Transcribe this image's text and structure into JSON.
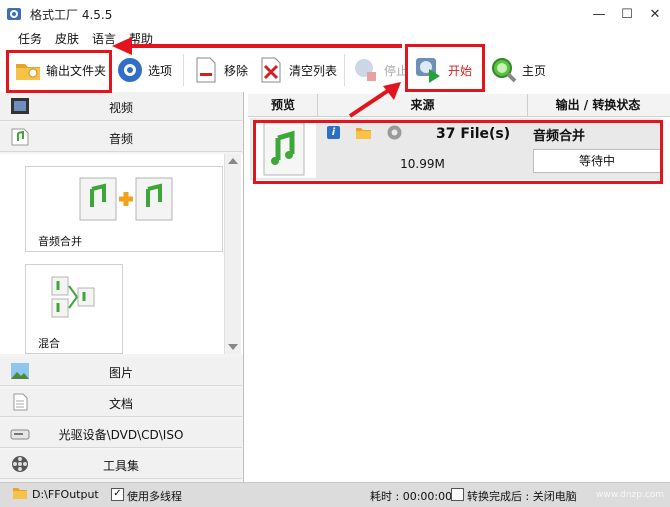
{
  "window": {
    "title": "格式工厂 4.5.5",
    "minimize": "—",
    "maximize": "☐",
    "close": "✕"
  },
  "menu": [
    "任务",
    "皮肤",
    "语言",
    "帮助"
  ],
  "toolbar": {
    "output_folder": "输出文件夹",
    "options": "选项",
    "remove": "移除",
    "clear_list": "清空列表",
    "stop": "停止",
    "start": "开始",
    "home": "主页"
  },
  "categories": {
    "video": "视频",
    "audio": "音频",
    "image": "图片",
    "document": "文档",
    "optical": "光驱设备\\DVD\\CD\\ISO",
    "tools": "工具集"
  },
  "audio_tools": {
    "merge": "音频合并",
    "mix": "混合"
  },
  "table": {
    "headers": [
      "预览",
      "来源",
      "输出 / 转换状态"
    ],
    "rows": [
      {
        "source_count": "37 File(s)",
        "size": "10.99M",
        "output": "音频合并",
        "status": "等待中"
      }
    ]
  },
  "statusbar": {
    "output_path": "D:\\FFOutput",
    "multithread": "使用多线程",
    "elapsed": "耗时 : 00:00:00",
    "after_done": "转换完成后 : 关闭电脑",
    "watermark": "www.dnzp.com"
  },
  "colors": {
    "highlight_red": "#e4141e",
    "start_text": "#d42020"
  }
}
